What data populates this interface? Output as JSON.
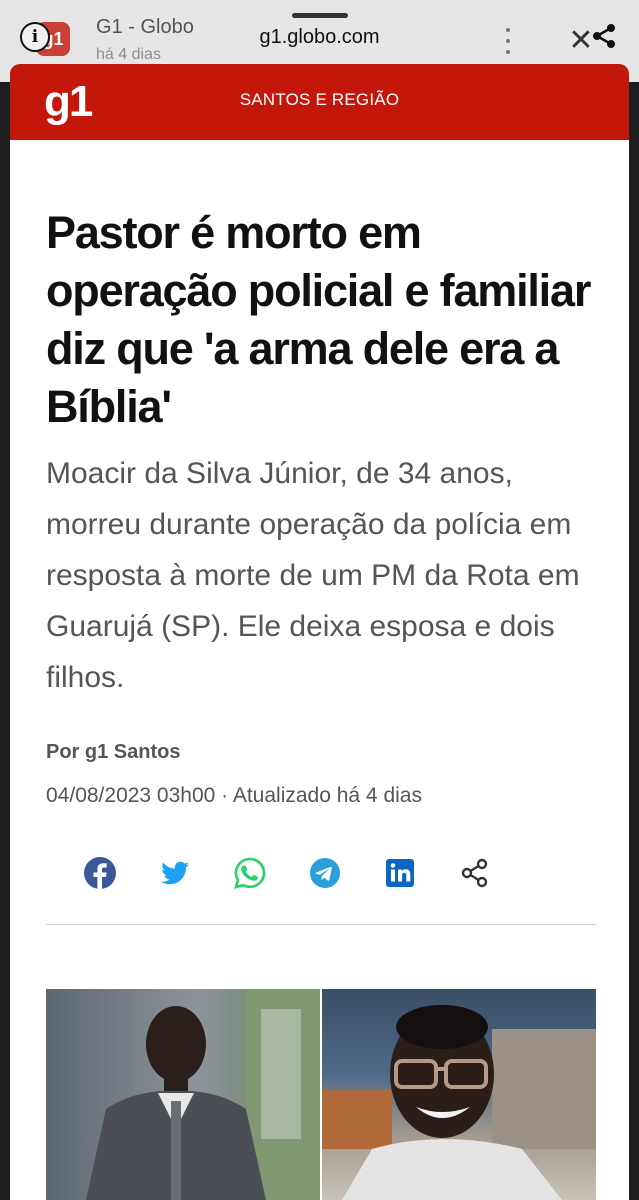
{
  "background_app": {
    "title": "G1 - Globo",
    "subtitle": "há 4 dias",
    "icon_text": "g1"
  },
  "browser": {
    "url": "g1.globo.com",
    "info_icon": "info-icon",
    "more_icon": "more-vert-icon",
    "close_icon": "close-icon",
    "share_icon": "share-icon"
  },
  "site": {
    "logo": "g1",
    "section": "SANTOS E REGIÃO",
    "brand_color": "#c4170c"
  },
  "article": {
    "headline": "Pastor é morto em operação policial e familiar diz que 'a arma dele era a Bíblia'",
    "subtitle": "Moacir da Silva Júnior, de 34 anos, morreu durante operação da polícia em resposta à morte de um PM da Rota em Guarujá (SP). Ele deixa esposa e dois filhos.",
    "byline": "Por g1 Santos",
    "dateline": "04/08/2023 03h00 · Atualizado há 4 dias"
  },
  "share_buttons": [
    {
      "name": "facebook",
      "icon": "facebook-icon",
      "color": "#3b5998"
    },
    {
      "name": "twitter",
      "icon": "twitter-icon",
      "color": "#1da1f2"
    },
    {
      "name": "whatsapp",
      "icon": "whatsapp-icon",
      "color": "#25d366"
    },
    {
      "name": "telegram",
      "icon": "telegram-icon",
      "color": "#2aa0d8"
    },
    {
      "name": "linkedin",
      "icon": "linkedin-icon",
      "color": "#0a66c2"
    },
    {
      "name": "share",
      "icon": "share-icon",
      "color": "#333333"
    }
  ]
}
